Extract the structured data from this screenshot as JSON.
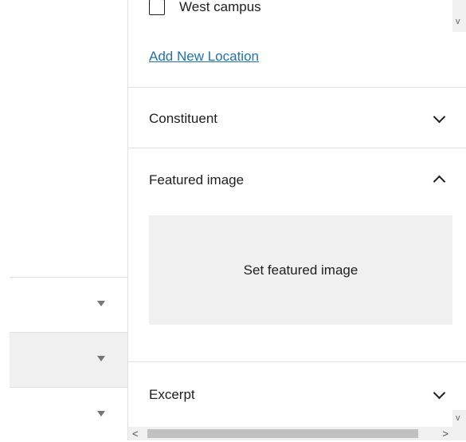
{
  "locations": {
    "checkbox_label": "West campus",
    "add_new_label": "Add New Location"
  },
  "panels": {
    "constituent": {
      "title": "Constituent",
      "expanded": false
    },
    "featured_image": {
      "title": "Featured image",
      "expanded": true,
      "set_label": "Set featured image"
    },
    "excerpt": {
      "title": "Excerpt",
      "expanded": false
    }
  },
  "scrollbar": {
    "left_arrow": "<",
    "right_arrow": ">",
    "down_arrow": "v"
  },
  "colors": {
    "link": "#2271b1",
    "panel_bg": "#f0f0f0",
    "border": "#e0e0e0"
  }
}
